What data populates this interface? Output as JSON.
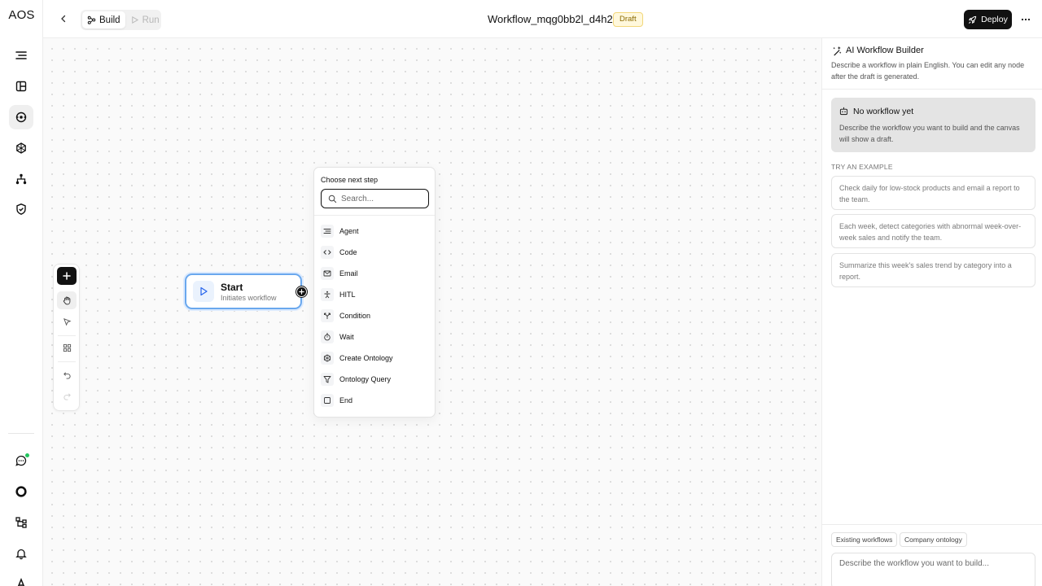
{
  "app": {
    "logo": "AOS"
  },
  "header": {
    "modes": [
      {
        "label": "Build",
        "active": true
      },
      {
        "label": "Run",
        "active": false
      }
    ],
    "workflow_title": "Workflow_mqg0bb2l_d4h2",
    "status_badge": "Draft",
    "deploy_label": "Deploy"
  },
  "canvas": {
    "start_node": {
      "title": "Start",
      "subtitle": "Initiates workflow"
    },
    "step_menu": {
      "title": "Choose next step",
      "search_placeholder": "Search...",
      "items": [
        {
          "label": "Agent",
          "icon": "agent-icon"
        },
        {
          "label": "Code",
          "icon": "code-icon"
        },
        {
          "label": "Email",
          "icon": "email-icon"
        },
        {
          "label": "HITL",
          "icon": "person-icon"
        },
        {
          "label": "Condition",
          "icon": "branch-icon"
        },
        {
          "label": "Wait",
          "icon": "timer-icon"
        },
        {
          "label": "Create Ontology",
          "icon": "ontology-icon"
        },
        {
          "label": "Ontology Query",
          "icon": "filter-icon"
        },
        {
          "label": "End",
          "icon": "stop-icon"
        }
      ]
    }
  },
  "panel": {
    "title": "AI Workflow Builder",
    "description": "Describe a workflow in plain English. You can edit any node after the draft is generated.",
    "empty_state": {
      "title": "No workflow yet",
      "description": "Describe the workflow you want to build and the canvas will show a draft."
    },
    "examples_label": "TRY AN EXAMPLE",
    "examples": [
      "Check daily for low-stock products and email a report to the team.",
      "Each week, detect categories with abnormal week-over-week sales and notify the team.",
      "Summarize this week's sales trend by category into a report."
    ],
    "context_chips": [
      "Existing workflows",
      "Company ontology"
    ],
    "prompt_placeholder": "Describe the workflow you want to build..."
  }
}
